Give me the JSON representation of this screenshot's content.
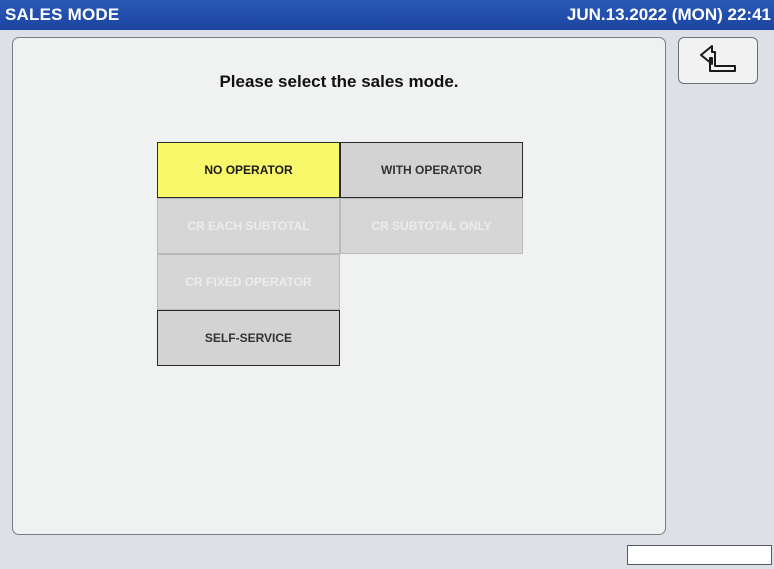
{
  "titlebar": {
    "title": "SALES MODE",
    "datetime": "JUN.13.2022 (MON)  22:41"
  },
  "prompt": "Please select the sales mode.",
  "modes": {
    "no_operator": {
      "label": "NO OPERATOR",
      "state": "selected"
    },
    "with_operator": {
      "label": "WITH OPERATOR",
      "state": "enabled"
    },
    "cr_each_subtotal": {
      "label": "CR EACH SUBTOTAL",
      "state": "disabled"
    },
    "cr_subtotal_only": {
      "label": "CR SUBTOTAL ONLY",
      "state": "disabled"
    },
    "cr_fixed_operator": {
      "label": "CR FIXED OPERATOR",
      "state": "disabled"
    },
    "self_service": {
      "label": "SELF-SERVICE",
      "state": "enabled"
    }
  },
  "back_button": {
    "icon": "return-arrow-icon"
  },
  "colors": {
    "titlebar": "#1c44a0",
    "selected": "#f8f86a",
    "button": "#d3d3d3",
    "panel": "#f0f1f1"
  }
}
